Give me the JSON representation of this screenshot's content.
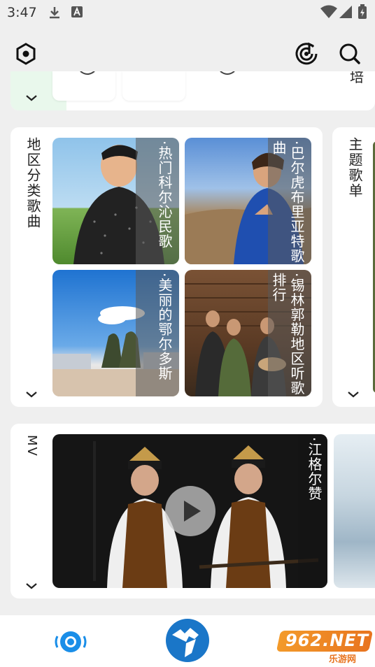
{
  "status_bar": {
    "time": "3:47"
  },
  "top_section": {
    "partial_text": "培"
  },
  "region_section": {
    "title": "地区分类歌曲",
    "tiles": [
      {
        "caption": "·热门科尔沁民歌"
      },
      {
        "caption": "·巴尔虎布里亚特歌曲"
      },
      {
        "caption": "·美丽的鄂尔多斯"
      },
      {
        "caption": "·锡林郭勒地区听歌排行"
      }
    ]
  },
  "theme_section": {
    "title": "主题歌单"
  },
  "mv_section": {
    "title": "MV",
    "video": {
      "caption": "·江格尔赞"
    }
  },
  "watermark": {
    "brand": "962.NET",
    "subtitle": "乐游网"
  },
  "colors": {
    "accent_blue": "#1a8ee8",
    "background": "#efefef"
  }
}
